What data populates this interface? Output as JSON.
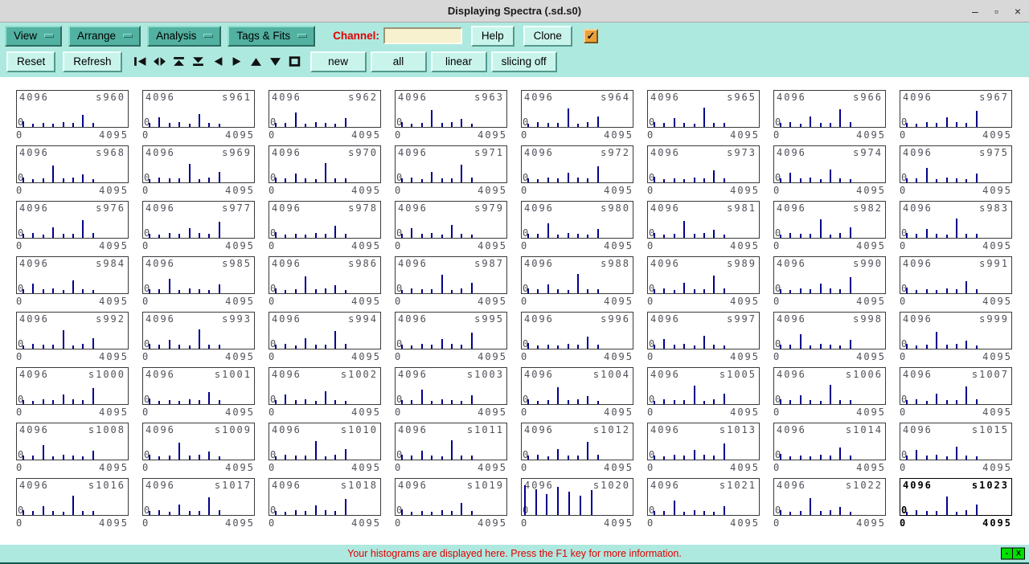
{
  "window": {
    "title": "Displaying Spectra (.sd.s0)",
    "controls": {
      "minimize": "–",
      "maximize": "▫",
      "close": "×"
    }
  },
  "icons": {
    "checkbox_check": "✓"
  },
  "menubar": {
    "menus": [
      {
        "label": "View"
      },
      {
        "label": "Arrange"
      },
      {
        "label": "Analysis"
      },
      {
        "label": "Tags & Fits"
      }
    ],
    "channel": {
      "label": "Channel:",
      "value": ""
    },
    "help_label": "Help",
    "clone_label": "Clone",
    "checkbox_checked": true
  },
  "toolbar": {
    "reset_label": "Reset",
    "refresh_label": "Refresh",
    "icon_buttons": [
      "skip-to-first",
      "expand-horizontal",
      "scroll-to-top",
      "scroll-to-bottom",
      "scroll-left",
      "scroll-right",
      "scroll-up",
      "scroll-down",
      "stop-square"
    ],
    "action_buttons": [
      "new",
      "all",
      "linear",
      "slicing off"
    ]
  },
  "statusbar": {
    "message": "Your histograms are displayed here. Press the F1 key for more information.",
    "widget": {
      "minimize": "-",
      "close": "X"
    }
  },
  "chart_data": {
    "type": "bar",
    "subtype": "histogram-grid",
    "rows": 8,
    "cols": 8,
    "y_max_label": "4096",
    "y_min_label": "0",
    "x_min_label": "0",
    "x_max_label": "4095",
    "x_range": [
      0,
      4095
    ],
    "y_range": [
      0,
      4096
    ],
    "spike_color": "#00008b",
    "selected_panel": "s1023",
    "x_positions": [
      0.05,
      0.14,
      0.23,
      0.32,
      0.41,
      0.5,
      0.59,
      0.68
    ],
    "height_patterns": {
      "H0": [
        0.16,
        0.1,
        0.12,
        0.1,
        0.13,
        0.11,
        0.34,
        0.12
      ],
      "H1": [
        0.12,
        0.28,
        0.11,
        0.13,
        0.1,
        0.36,
        0.12,
        0.1
      ],
      "H2": [
        0.11,
        0.12,
        0.42,
        0.1,
        0.14,
        0.12,
        0.1,
        0.26
      ],
      "H3": [
        0.13,
        0.1,
        0.12,
        0.48,
        0.11,
        0.13,
        0.22,
        0.1
      ],
      "H4": [
        0.1,
        0.14,
        0.11,
        0.12,
        0.52,
        0.1,
        0.13,
        0.3
      ],
      "H5": [
        0.14,
        0.11,
        0.26,
        0.12,
        0.1,
        0.55,
        0.12,
        0.11
      ],
      "H6": [
        0.12,
        0.13,
        0.1,
        0.3,
        0.12,
        0.11,
        0.5,
        0.13
      ],
      "H7": [
        0.11,
        0.1,
        0.13,
        0.11,
        0.28,
        0.13,
        0.12,
        0.45
      ]
    },
    "panels": [
      {
        "name": "s960",
        "pattern": "H0"
      },
      {
        "name": "s961",
        "pattern": "H1"
      },
      {
        "name": "s962",
        "pattern": "H2"
      },
      {
        "name": "s963",
        "pattern": "H3"
      },
      {
        "name": "s964",
        "pattern": "H4"
      },
      {
        "name": "s965",
        "pattern": "H5"
      },
      {
        "name": "s966",
        "pattern": "H6"
      },
      {
        "name": "s967",
        "pattern": "H7"
      },
      {
        "name": "s968",
        "pattern": "H3"
      },
      {
        "name": "s969",
        "pattern": "H4"
      },
      {
        "name": "s970",
        "pattern": "H5"
      },
      {
        "name": "s971",
        "pattern": "H6"
      },
      {
        "name": "s972",
        "pattern": "H7"
      },
      {
        "name": "s973",
        "pattern": "H0"
      },
      {
        "name": "s974",
        "pattern": "H1"
      },
      {
        "name": "s975",
        "pattern": "H2"
      },
      {
        "name": "s976",
        "pattern": "H6"
      },
      {
        "name": "s977",
        "pattern": "H7"
      },
      {
        "name": "s978",
        "pattern": "H0"
      },
      {
        "name": "s979",
        "pattern": "H1"
      },
      {
        "name": "s980",
        "pattern": "H2"
      },
      {
        "name": "s981",
        "pattern": "H3"
      },
      {
        "name": "s982",
        "pattern": "H4"
      },
      {
        "name": "s983",
        "pattern": "H5"
      },
      {
        "name": "s984",
        "pattern": "H1"
      },
      {
        "name": "s985",
        "pattern": "H2"
      },
      {
        "name": "s986",
        "pattern": "H3"
      },
      {
        "name": "s987",
        "pattern": "H4"
      },
      {
        "name": "s988",
        "pattern": "H5"
      },
      {
        "name": "s989",
        "pattern": "H6"
      },
      {
        "name": "s990",
        "pattern": "H7"
      },
      {
        "name": "s991",
        "pattern": "H0"
      },
      {
        "name": "s992",
        "pattern": "H4"
      },
      {
        "name": "s993",
        "pattern": "H5"
      },
      {
        "name": "s994",
        "pattern": "H6"
      },
      {
        "name": "s995",
        "pattern": "H7"
      },
      {
        "name": "s996",
        "pattern": "H0"
      },
      {
        "name": "s997",
        "pattern": "H1"
      },
      {
        "name": "s998",
        "pattern": "H2"
      },
      {
        "name": "s999",
        "pattern": "H3"
      },
      {
        "name": "s1000",
        "pattern": "H7"
      },
      {
        "name": "s1001",
        "pattern": "H0"
      },
      {
        "name": "s1002",
        "pattern": "H1"
      },
      {
        "name": "s1003",
        "pattern": "H2"
      },
      {
        "name": "s1004",
        "pattern": "H3"
      },
      {
        "name": "s1005",
        "pattern": "H4"
      },
      {
        "name": "s1006",
        "pattern": "H5"
      },
      {
        "name": "s1007",
        "pattern": "H6"
      },
      {
        "name": "s1008",
        "pattern": "H2"
      },
      {
        "name": "s1009",
        "pattern": "H3"
      },
      {
        "name": "s1010",
        "pattern": "H4"
      },
      {
        "name": "s1011",
        "pattern": "H5"
      },
      {
        "name": "s1012",
        "pattern": "H6"
      },
      {
        "name": "s1013",
        "pattern": "H7"
      },
      {
        "name": "s1014",
        "pattern": "H0"
      },
      {
        "name": "s1015",
        "pattern": "H1"
      },
      {
        "name": "s1016",
        "pattern": "H5"
      },
      {
        "name": "s1017",
        "pattern": "H6"
      },
      {
        "name": "s1018",
        "pattern": "H7"
      },
      {
        "name": "s1019",
        "pattern": "H0"
      },
      {
        "name": "s1020",
        "x": [
          0.02,
          0.12,
          0.22,
          0.32,
          0.42,
          0.52,
          0.62
        ],
        "heights": [
          0.85,
          0.72,
          0.6,
          0.8,
          0.66,
          0.55,
          0.7
        ]
      },
      {
        "name": "s1021",
        "pattern": "H2"
      },
      {
        "name": "s1022",
        "pattern": "H3"
      },
      {
        "name": "s1023",
        "pattern": "H4"
      }
    ]
  }
}
